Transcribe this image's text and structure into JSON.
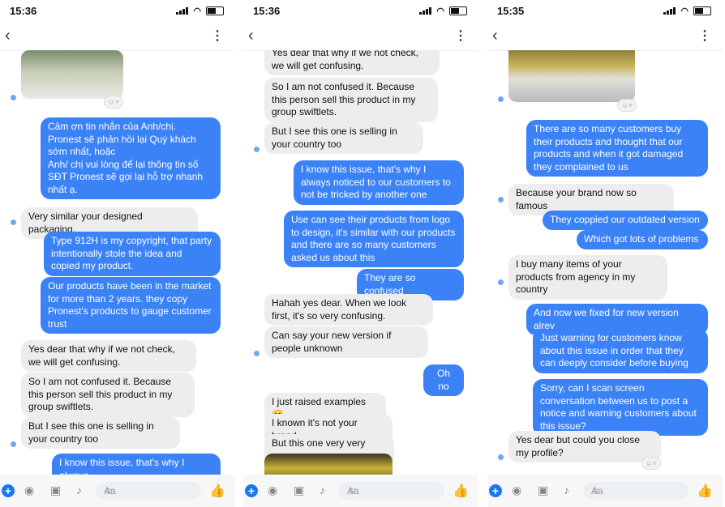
{
  "panels": [
    {
      "time": "15:36",
      "messages": [
        {
          "dir": "out",
          "text": "Cảm ơn tin nhắn của Anh/chị.\nPronest sẽ phản hồi lại Quý khách sớm nhất, hoặc\nAnh/ chị vui lòng để lại thông tin số SĐT Pronest sẽ gọi lại hỗ trợ nhanh nhất ạ."
        },
        {
          "dir": "in",
          "text": "Very similar your designed packaging."
        },
        {
          "dir": "out",
          "text": "Type 912H is my copyright, that party intentionally stole the idea and copied my product."
        },
        {
          "dir": "out",
          "text": "Our products have been in the market for more than 2 years.  they copy Pronest's products to gauge customer trust"
        },
        {
          "dir": "in",
          "text": "Yes dear that why if we not check, we will get confusing."
        },
        {
          "dir": "in",
          "text": "So I am not confused it. Because this person sell this product in my group swiftlets."
        },
        {
          "dir": "in",
          "text": "But I see this one is selling in your country too"
        },
        {
          "dir": "out",
          "text": "I know this issue, that's why I always"
        }
      ]
    },
    {
      "time": "15:36",
      "messages": [
        {
          "dir": "in",
          "text": "Yes dear that why if we not check, we will get confusing."
        },
        {
          "dir": "in",
          "text": "So I am not confused it. Because this person sell this product in my group swiftlets."
        },
        {
          "dir": "in",
          "text": "But I see this one is selling in your country too"
        },
        {
          "dir": "out",
          "text": "I know this issue, that's why I always noticed to our customers to not be tricked by another one"
        },
        {
          "dir": "out",
          "text": "Use can see their products from logo to design, it's similar with our products and there are so many customers asked us about this"
        },
        {
          "dir": "out",
          "text": "They are so confused"
        },
        {
          "dir": "in",
          "text": "Hahah yes dear. When we look first, it's so very confusing."
        },
        {
          "dir": "in",
          "text": "Can say your new version if people unknown"
        },
        {
          "dir": "out",
          "text": "Oh no"
        },
        {
          "dir": "in",
          "text": "I just raised examples 😄"
        },
        {
          "dir": "in",
          "text": "I known it's not your brand."
        },
        {
          "dir": "in",
          "text": "But this one very very copy"
        }
      ]
    },
    {
      "time": "15:35",
      "messages": [
        {
          "dir": "out",
          "text": "There are so many customers buy their products and thought that our products and when it got damaged they complained to us"
        },
        {
          "dir": "in",
          "text": "Because your brand now so famous"
        },
        {
          "dir": "out",
          "text": "They coppied our outdated version"
        },
        {
          "dir": "out",
          "text": "Which got lots of problems"
        },
        {
          "dir": "in",
          "text": "I buy many items of your products from agency in my country"
        },
        {
          "dir": "out",
          "text": "And now we fixed for new version alrey"
        },
        {
          "dir": "out",
          "text": "Just warning for customers know about this issue in order that they can deeply consider before buying"
        },
        {
          "dir": "out",
          "text": "Sorry, can I scan screen conversation between us to post a notice and warning customers about this issue?"
        },
        {
          "dir": "in",
          "text": "Yes dear but could you close my profile?"
        }
      ]
    }
  ],
  "composer": {
    "placeholder": "Aa"
  },
  "icons": {
    "back": "chevron-left-icon",
    "more": "more-vertical-icon",
    "plus": "plus-icon",
    "camera": "camera-icon",
    "gallery": "image-icon",
    "mic": "microphone-icon",
    "emoji": "smiley-icon",
    "like": "thumbs-up-icon"
  },
  "colors": {
    "outgoing": "#3b82f6",
    "incoming": "#ededed",
    "accent": "#1877f2"
  }
}
